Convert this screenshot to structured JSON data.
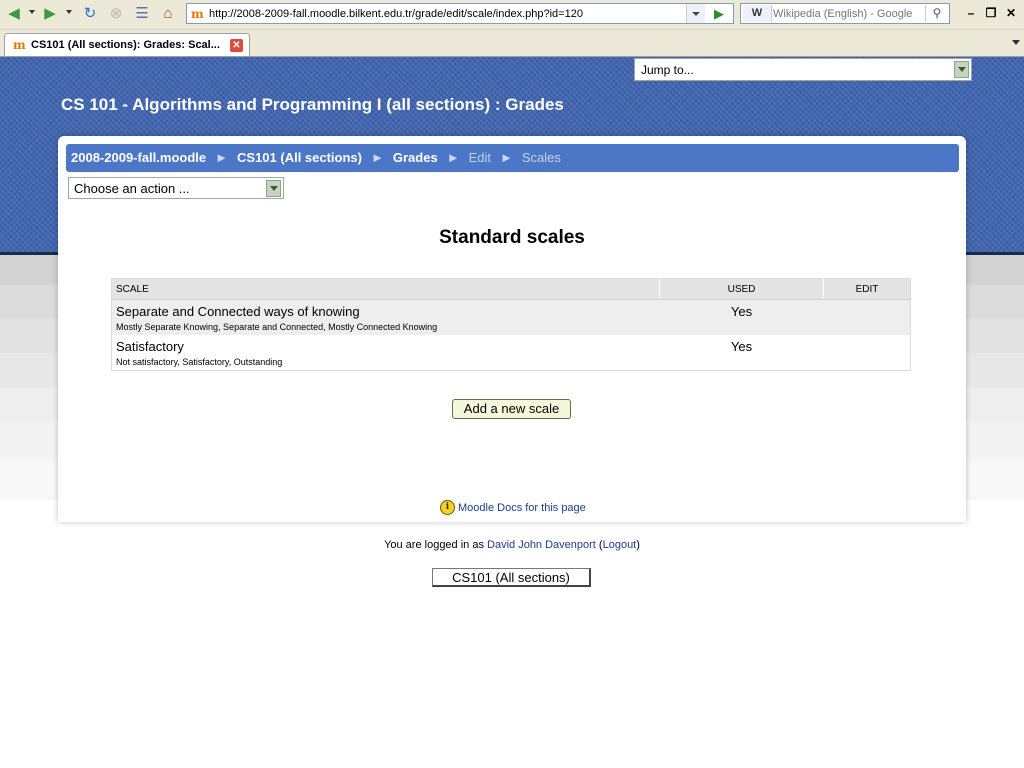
{
  "browser": {
    "url": "http://2008-2009-fall.moodle.bilkent.edu.tr/grade/edit/scale/index.php?id=120",
    "search_placeholder": "Wikipedia (English) - Google",
    "tab_title": "CS101 (All sections): Grades: Scal...",
    "favicon_letter": "m",
    "search_engine_icon": "W"
  },
  "page": {
    "jump_to": "Jump to...",
    "course_title": "CS 101 - Algorithms and Programming I (all sections) : Grades",
    "breadcrumb": {
      "site": "2008-2009-fall.moodle",
      "course": "CS101 (All sections)",
      "grades": "Grades",
      "edit": "Edit",
      "scales": "Scales",
      "separator": "►"
    },
    "action_select": "Choose an action ...",
    "heading": "Standard scales",
    "table": {
      "headers": {
        "scale": "SCALE",
        "used": "USED",
        "edit": "EDIT"
      },
      "rows": [
        {
          "name": "Separate and Connected ways of knowing",
          "items": "Mostly Separate Knowing, Separate and Connected, Mostly Connected Knowing",
          "used": "Yes"
        },
        {
          "name": "Satisfactory",
          "items": "Not satisfactory, Satisfactory, Outstanding",
          "used": "Yes"
        }
      ]
    },
    "add_button": "Add a new scale",
    "docs_link": "Moodle Docs for this page",
    "login": {
      "prefix": "You are logged in as ",
      "user": "David John Davenport",
      "open": " (",
      "logout": "Logout",
      "close": ")"
    },
    "course_button": "CS101 (All sections)"
  },
  "colors": {
    "header_blue": "#3d63b0",
    "breadcrumb_blue": "#4b77c6",
    "link": "#1d3c8a",
    "button_bg": "#f5f7dc"
  }
}
